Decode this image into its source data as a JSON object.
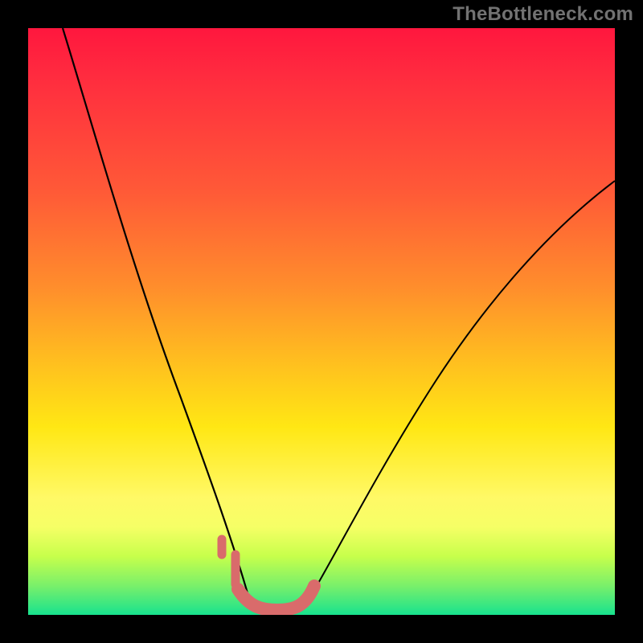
{
  "watermark": "TheBottleneck.com",
  "chart_data": {
    "type": "line",
    "title": "",
    "xlabel": "",
    "ylabel": "",
    "xlim": [
      0,
      1
    ],
    "ylim": [
      0,
      1
    ],
    "series": [
      {
        "name": "curve-left",
        "x": [
          0.06,
          0.1,
          0.14,
          0.18,
          0.22,
          0.26,
          0.3,
          0.33,
          0.355,
          0.38
        ],
        "y": [
          1.0,
          0.86,
          0.71,
          0.56,
          0.42,
          0.29,
          0.18,
          0.1,
          0.04,
          0.015
        ]
      },
      {
        "name": "curve-right",
        "x": [
          0.47,
          0.5,
          0.55,
          0.62,
          0.7,
          0.8,
          0.9,
          1.0
        ],
        "y": [
          0.015,
          0.05,
          0.13,
          0.25,
          0.38,
          0.52,
          0.64,
          0.74
        ]
      },
      {
        "name": "tick-left",
        "x": [
          0.332,
          0.332,
          0.355,
          0.355
        ],
        "y": [
          0.12,
          0.085,
          0.085,
          0.05
        ]
      },
      {
        "name": "valley-highlight",
        "x": [
          0.36,
          0.38,
          0.4,
          0.425,
          0.45,
          0.47,
          0.49
        ],
        "y": [
          0.04,
          0.018,
          0.012,
          0.012,
          0.015,
          0.028,
          0.055
        ]
      }
    ],
    "gradient_stops": [
      {
        "pos": 0.0,
        "color": "#ff173e"
      },
      {
        "pos": 0.28,
        "color": "#ff5a37"
      },
      {
        "pos": 0.58,
        "color": "#ffc31e"
      },
      {
        "pos": 0.8,
        "color": "#fff966"
      },
      {
        "pos": 0.95,
        "color": "#7af06a"
      },
      {
        "pos": 1.0,
        "color": "#18e28e"
      }
    ]
  }
}
